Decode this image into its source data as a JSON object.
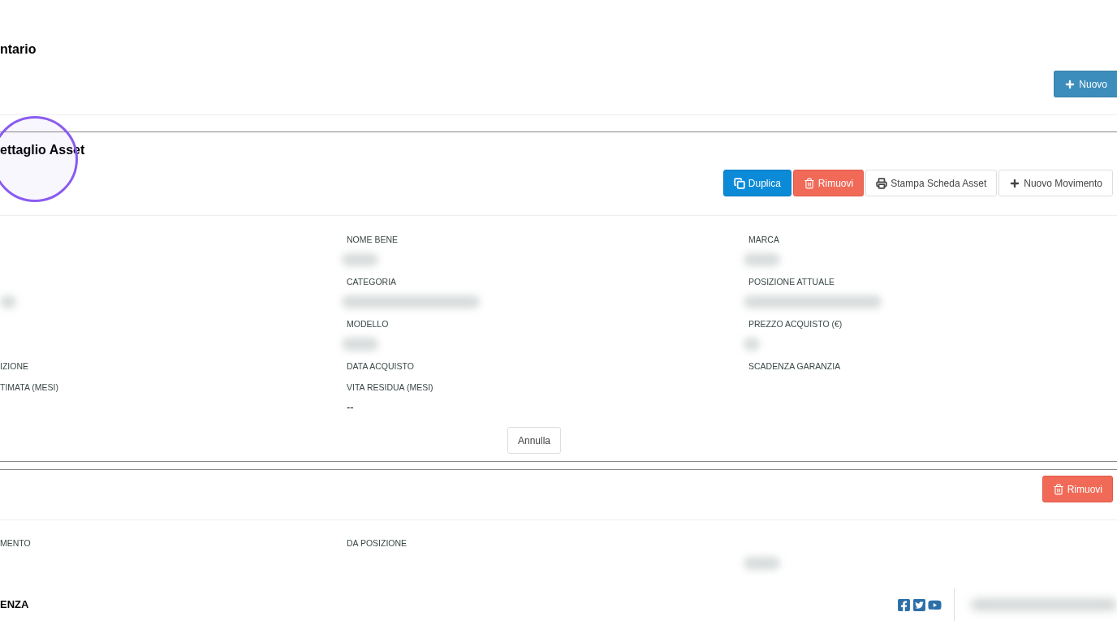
{
  "page_header": {
    "title": "ntario",
    "actions": [
      {
        "label": "Nuovo",
        "kind": "info"
      }
    ]
  },
  "detail": {
    "title": "ettaglio Asset",
    "actions": [
      {
        "label": "Duplica",
        "kind": "primary"
      },
      {
        "label": "Rimuovi",
        "kind": "danger"
      },
      {
        "label": "Stampa Scheda Asset",
        "kind": "default"
      },
      {
        "label": "Nuovo Movimento",
        "kind": "default"
      }
    ],
    "rows": [
      {
        "cells": [
          null,
          {
            "label": "NOME BENE"
          },
          {
            "label": "MARCA"
          }
        ]
      },
      {
        "cells": [
          null,
          {
            "label": "CATEGORIA"
          },
          {
            "label": "POSIZIONE ATTUALE"
          }
        ]
      },
      {
        "cells": [
          null,
          {
            "label": "MODELLO"
          },
          {
            "label": "PREZZO ACQUISTO (€)"
          }
        ]
      },
      {
        "cells": [
          {
            "label": "IZIONE"
          },
          {
            "label": "DATA ACQUISTO"
          },
          {
            "label": "SCADENZA GARANZIA"
          }
        ]
      },
      {
        "cells": [
          {
            "label": "TIMATA (MESI)"
          },
          {
            "label": "VITA RESIDUA (MESI)",
            "value": "--"
          },
          null
        ]
      }
    ],
    "cancel": {
      "label": "Annulla"
    }
  },
  "movement": {
    "actions": [
      {
        "label": "Rimuovi",
        "kind": "danger"
      }
    ],
    "cells": [
      {
        "label": "MENTO"
      },
      {
        "label": "DA POSIZIONE"
      },
      null
    ]
  },
  "footer": {
    "text": "ENZA"
  }
}
